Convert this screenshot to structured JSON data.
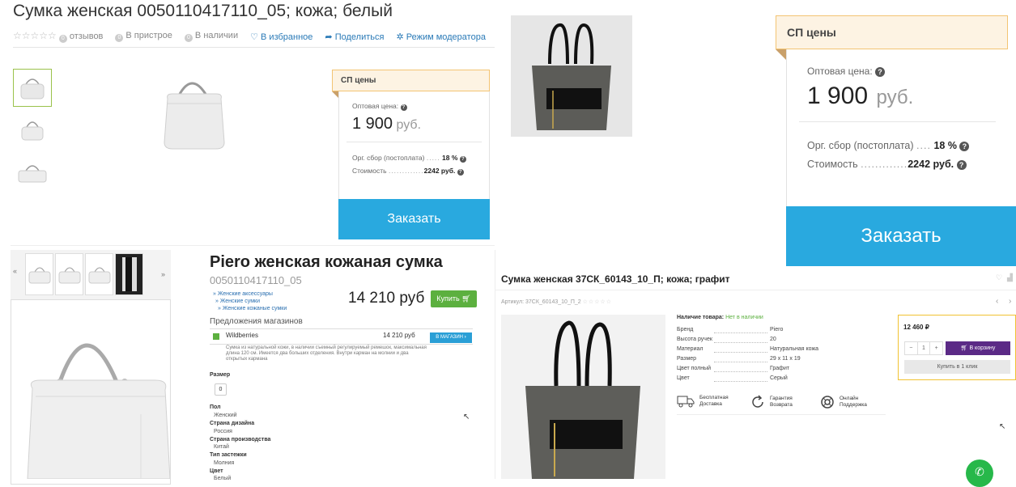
{
  "panel1": {
    "title": "Сумка женская 0050110417110_05; кожа; белый",
    "stars": "☆☆☆☆☆",
    "reviews_count": "0",
    "reviews_label": "отзывов",
    "in_pristroy_count": "0",
    "in_pristroy_label": "В пристрое",
    "in_stock_count": "0",
    "in_stock_label": "В наличии",
    "favorites_label": "В избранное",
    "share_label": "Поделиться",
    "moderator_label": "Режим модератора"
  },
  "price_small": {
    "header": "СП цены",
    "wholesale_label": "Оптовая цена:",
    "price_value": "1 900",
    "price_currency": "руб.",
    "org_fee_label": "Орг. сбор (постоплата)",
    "org_fee_value": "18 %",
    "cost_label": "Стоимость",
    "cost_value": "2242 руб.",
    "order_button": "Заказать"
  },
  "price_large": {
    "header": "СП цены",
    "wholesale_label": "Оптовая цена:",
    "price_value": "1 900",
    "price_currency": "руб.",
    "org_fee_label": "Орг. сбор (постоплата)",
    "org_fee_value": "18 %",
    "cost_label": "Стоимость",
    "cost_value": "2242 руб.",
    "order_button": "Заказать"
  },
  "panel_bl": {
    "prev_arrow": "«",
    "next_arrow": "»",
    "title": "Piero женская кожаная сумка",
    "code": "0050110417110_05",
    "breadcrumbs": [
      "» Женские аксессуары",
      "» Женские сумки",
      "» Женские кожаные сумки"
    ],
    "price": "14 210 руб",
    "buy_label": "Купить",
    "offers_header": "Предложения магазинов",
    "shop_name": "Wildberries",
    "shop_price": "14 210 руб",
    "shop_button": "В МАГАЗИН",
    "description": "Сумка из натуральной кожи, в наличии съемный регулируемый ремешок, максимальная длина 120 см. Имеется два больших отделения. Внутри карман на молнии и два открытых кармана",
    "size_label": "Размер",
    "size_value": "0",
    "specs": [
      {
        "k": "Пол",
        "v": "Женский"
      },
      {
        "k": "Страна дизайна",
        "v": "Россия"
      },
      {
        "k": "Страна производства",
        "v": "Китай"
      },
      {
        "k": "Тип застежки",
        "v": "Молния"
      },
      {
        "k": "Цвет",
        "v": "Белый"
      }
    ]
  },
  "panel_br": {
    "title": "Сумка женская 37СК_60143_10_П; кожа; графит",
    "article": "Артикул: 37СК_60143_10_П_2",
    "stars": "☆☆☆☆☆",
    "availability_label": "Наличие товара:",
    "availability_value": "Нет в наличии",
    "specs": [
      {
        "k": "Бренд",
        "v": "Piero"
      },
      {
        "k": "Высота ручек",
        "v": "20"
      },
      {
        "k": "Материал",
        "v": "Натуральная кожа"
      },
      {
        "k": "Размер",
        "v": "29 x 11 x 19"
      },
      {
        "k": "Цвет полный",
        "v": "Графит"
      },
      {
        "k": "Цвет",
        "v": "Серый"
      }
    ],
    "feature1": "Бесплатная\nДоставка",
    "feature2": "Гарантия\nВозврата",
    "feature3": "Онлайн\nПоддержка",
    "price": "12 460 ₽",
    "qty_minus": "−",
    "qty_value": "1",
    "qty_plus": "+",
    "cart_button": "В корзину",
    "one_click_button": "Купить в 1 клик"
  },
  "colors": {
    "accent_blue": "#29a9df",
    "buy_green": "#5cb03f",
    "cart_purple": "#5b2a86",
    "price_border": "#f3c473"
  }
}
